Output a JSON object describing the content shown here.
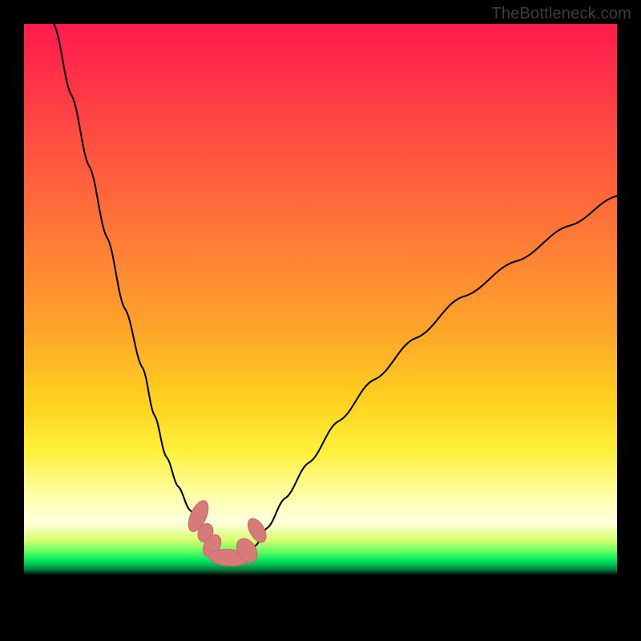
{
  "watermark": "TheBottleneck.com",
  "colors": {
    "curve_stroke": "#000000",
    "marker_fill": "#d77a7a",
    "marker_stroke": "#cc6a6a"
  },
  "chart_data": {
    "type": "line",
    "title": "",
    "xlabel": "",
    "ylabel": "",
    "xlim": [
      0,
      100
    ],
    "ylim": [
      0,
      100
    ],
    "grid": false,
    "legend": false,
    "note": "Axes, tick labels and numeric scale are not rendered in the source image; values below are relative (0–100) estimates read from geometry. y is drawn descending (0 at top, 100 at bottom).",
    "series": [
      {
        "name": "left-curve",
        "x": [
          5,
          8,
          11,
          14,
          17,
          20,
          22,
          24,
          26,
          28,
          29.5,
          30.5,
          31.5,
          33,
          35
        ],
        "y": [
          0,
          12,
          24,
          36,
          48,
          58,
          66,
          73,
          78,
          82,
          84.5,
          86,
          87.5,
          89,
          90
        ]
      },
      {
        "name": "right-curve",
        "x": [
          37,
          39,
          41,
          44,
          48,
          53,
          59,
          66,
          74,
          83,
          92,
          100
        ],
        "y": [
          90,
          88,
          85,
          80,
          74,
          67,
          60,
          53,
          46,
          40,
          34,
          29
        ]
      },
      {
        "name": "trough-band",
        "x": [
          31,
          32,
          33,
          34,
          35,
          36,
          37,
          38
        ],
        "y": [
          88,
          89,
          89.5,
          90,
          90,
          89.5,
          89,
          88
        ]
      }
    ],
    "markers": [
      {
        "cx": 29.4,
        "cy": 83.0,
        "rx": 1.3,
        "ry": 2.8,
        "rot": 24
      },
      {
        "cx": 30.6,
        "cy": 85.8,
        "rx": 1.2,
        "ry": 1.6,
        "rot": 24
      },
      {
        "cx": 31.7,
        "cy": 88.0,
        "rx": 1.3,
        "ry": 2.0,
        "rot": 30
      },
      {
        "cx": 34.5,
        "cy": 90.0,
        "rx": 3.3,
        "ry": 1.4,
        "rot": 4
      },
      {
        "cx": 37.6,
        "cy": 88.8,
        "rx": 1.5,
        "ry": 2.2,
        "rot": -32
      },
      {
        "cx": 39.3,
        "cy": 85.4,
        "rx": 1.2,
        "ry": 2.2,
        "rot": -30
      }
    ]
  }
}
